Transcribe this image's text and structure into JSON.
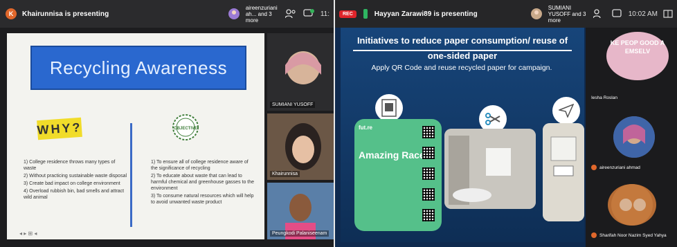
{
  "left": {
    "presenter_initial": "K",
    "presenter_text": "Khairunnisa is presenting",
    "participants_summary": "aireenzuriani ah... and 3 more",
    "participant_count_icon": "people-icon",
    "chat_icon": "chat-icon",
    "clock_partial": "11:",
    "slide": {
      "title": "Recycling Awareness",
      "why_label": "WHY?",
      "objective_label": "OBJECTIVE",
      "why_items": [
        "1) College residence throws many types of waste",
        "2) Without practicing sustainable waste disposal",
        "3) Create bad impact on college environment",
        "4) Overload rubbish bin, bad smells and attract wild animal"
      ],
      "objective_items": [
        "1) To ensure all of college residence aware of the significance of recycling",
        "2) To educate about waste that can lead to harmful chemical and greenhouse gasses to the environment",
        "3) To consume natural resources which will help to avoid unwanted waste product"
      ],
      "controls": "◂ ▸ ⊞ ◂"
    },
    "tiles": [
      {
        "name": "SUMIANI YUSOFF"
      },
      {
        "name": "Khairunnisa"
      },
      {
        "name": "Peungkodi Palaniseenam"
      }
    ]
  },
  "right": {
    "rec_label": "REC",
    "presenter_text": "Hayyan Zarawi89 is presenting",
    "participants_summary": "SUMIANI YUSOFF and 3 more",
    "clock": "10:02 AM",
    "slide": {
      "title": "Initiatives to reduce paper consumption/ reuse of one-sided paper",
      "subtitle": "Apply QR Code and reuse recycled paper for campaign.",
      "card_heading": "Amazing Race",
      "card_brand": "fut.re"
    },
    "participants": [
      {
        "name": "Iesha Roslan"
      },
      {
        "name": "aireenzuriani ahmad"
      },
      {
        "name": "Sharifah Noor Nazim Syed Yahya"
      }
    ],
    "overlay_text": "KE PEOP GOOD A EMSELV"
  }
}
